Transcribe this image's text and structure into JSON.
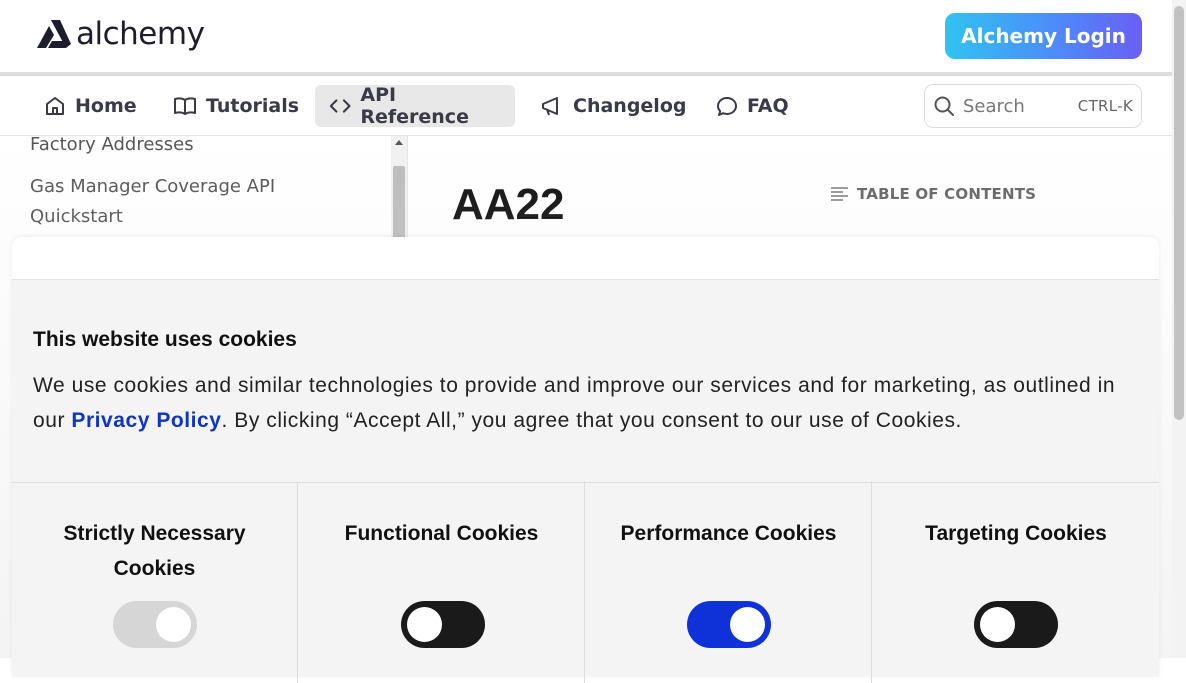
{
  "header": {
    "logo_text": "alchemy",
    "login_label": "Alchemy Login"
  },
  "nav": {
    "items": [
      {
        "label": "Home",
        "icon": "home-icon"
      },
      {
        "label": "Tutorials",
        "icon": "book-icon"
      },
      {
        "label": "API Reference",
        "icon": "code-icon",
        "active": true
      },
      {
        "label": "Changelog",
        "icon": "megaphone-icon"
      },
      {
        "label": "FAQ",
        "icon": "chat-bubble-icon"
      }
    ],
    "search_placeholder": "Search",
    "search_shortcut": "CTRL-K"
  },
  "sidebar": {
    "items": [
      {
        "label": "Factory Addresses"
      },
      {
        "label": "Gas Manager Coverage API"
      },
      {
        "label": "Quickstart"
      }
    ]
  },
  "content": {
    "title": "AA22",
    "toc_label": "TABLE OF CONTENTS"
  },
  "cookie_modal": {
    "title": "This website uses cookies",
    "desc_before": "We use cookies and similar technologies to provide and improve our services and for marketing, as outlined in our ",
    "privacy_link": "Privacy Policy",
    "desc_after": ". By clicking “Accept All,” you agree that you consent to our use of Cookies.",
    "categories": [
      {
        "title": "Strictly Necessary Cookies",
        "state": "disabled"
      },
      {
        "title": "Functional Cookies",
        "state": "off"
      },
      {
        "title": "Performance Cookies",
        "state": "on"
      },
      {
        "title": "Targeting Cookies",
        "state": "off"
      }
    ]
  },
  "colors": {
    "login_gradient_start": "#31c3f0",
    "login_gradient_end": "#6a5ff5",
    "link_blue": "#0e35c8",
    "toggle_on": "#0f32d8",
    "toggle_off": "#1a1a1a"
  }
}
